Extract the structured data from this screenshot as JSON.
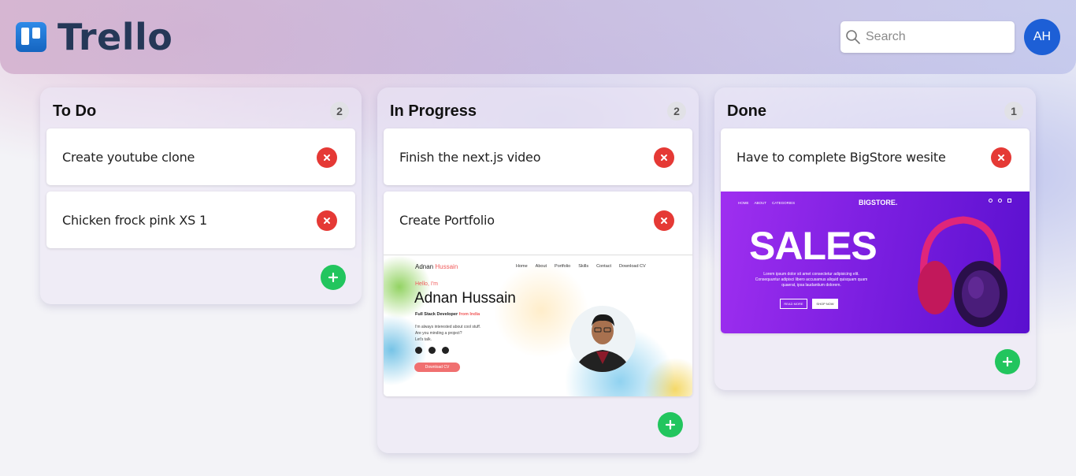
{
  "app": {
    "name": "Trello"
  },
  "header": {
    "search_placeholder": "Search",
    "avatar_initials": "AH"
  },
  "columns": [
    {
      "title": "To Do",
      "count": "2",
      "cards": [
        {
          "text": "Create youtube clone"
        },
        {
          "text": "Chicken frock pink XS 1"
        }
      ]
    },
    {
      "title": "In Progress",
      "count": "2",
      "cards": [
        {
          "text": "Finish the next.js video"
        },
        {
          "text": "Create Portfolio",
          "image": {
            "brand_first": "Adnan",
            "brand_last": "Hussain",
            "nav": [
              "Home",
              "About",
              "Portfolio",
              "Skills",
              "Contact",
              "Download CV"
            ],
            "greeting": "Hello, I'm",
            "name": "Adnan Hussain",
            "role_prefix": "Full Stack Developer",
            "role_suffix": "from India",
            "line1": "I'm always interested about cool stuff.",
            "line2": "Are you minding a project?",
            "line3": "Let's talk.",
            "cta": "Download CV"
          }
        }
      ]
    },
    {
      "title": "Done",
      "count": "1",
      "cards": [
        {
          "text": "Have to complete BigStore wesite",
          "image": {
            "nav": [
              "HOME",
              "ABOUT",
              "CATEGORIES"
            ],
            "brand": "BIGSTORE.",
            "headline": "SALES",
            "body1": "Lorem ipsum dolor sit amet consectetur adipisicing elit.",
            "body2": "Consequuntur adipisci libero accusamus aliquid quisquam quam",
            "body3": "quaerat, ipsa laudantium dolorem.",
            "btn1": "READ MORE",
            "btn2": "SHOP NOW"
          }
        }
      ]
    }
  ],
  "colors": {
    "delete": "#e53935",
    "add": "#22c55e",
    "avatar": "#1d5fd6",
    "logo": "#253858"
  },
  "icons": {
    "search": "search-icon",
    "delete": "close-icon",
    "add": "plus-icon",
    "logo": "trello-logo-icon"
  }
}
